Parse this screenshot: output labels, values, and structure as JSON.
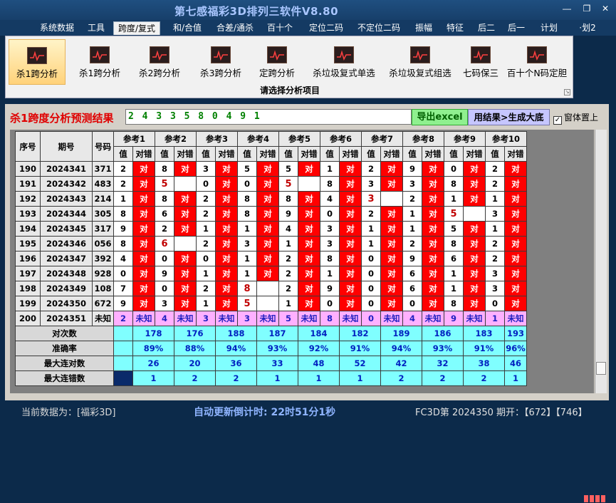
{
  "app": {
    "title": "第七感福彩3D排列三软件V8.80"
  },
  "menu": [
    {
      "label": "系统数据",
      "active": false
    },
    {
      "label": "工具",
      "active": false
    },
    {
      "label": "跨度/复式",
      "active": true
    },
    {
      "label": "和/合值",
      "active": false
    },
    {
      "label": "合差/通杀",
      "active": false
    },
    {
      "label": "百十个",
      "active": false
    },
    {
      "label": "定位二码",
      "active": false
    },
    {
      "label": "不定位二码",
      "active": false
    },
    {
      "label": "振幅",
      "active": false
    },
    {
      "label": "特征",
      "active": false
    },
    {
      "label": "后二",
      "active": false
    },
    {
      "label": "后一",
      "active": false
    },
    {
      "label": "计划",
      "active": false
    },
    {
      "label": "·划2",
      "active": false
    }
  ],
  "ribbon": {
    "caption": "请选择分析项目",
    "buttons": [
      {
        "label": "杀1跨分析",
        "selected": true
      },
      {
        "label": "杀1跨分析",
        "selected": false
      },
      {
        "label": "杀2跨分析",
        "selected": false
      },
      {
        "label": "杀3跨分析",
        "selected": false
      },
      {
        "label": "定跨分析",
        "selected": false
      },
      {
        "label": "杀垃圾复式单选",
        "selected": false
      },
      {
        "label": "杀垃圾复式组选",
        "selected": false
      },
      {
        "label": "七码保三",
        "selected": false
      },
      {
        "label": "百十个N码定胆",
        "selected": false
      }
    ]
  },
  "result": {
    "label": "杀1跨度分析预测结果",
    "value": "2 4 3 3 5 8 0 4 9 1",
    "export_button": "导出excel",
    "generate_button": "用结果>生成大底",
    "pin_label": "窗体置上",
    "pin_checked": true
  },
  "table": {
    "col_seq": "序号",
    "col_period": "期号",
    "col_number": "号码",
    "groups": [
      "参考1",
      "参考2",
      "参考3",
      "参考4",
      "参考5",
      "参考6",
      "参考7",
      "参考8",
      "参考9",
      "参考10"
    ],
    "sub_value": "值",
    "sub_check": "对错",
    "hit_text": "对",
    "rows": [
      {
        "seq": "190",
        "period": "2024341",
        "number": "371",
        "cells": [
          [
            "2",
            1
          ],
          [
            "8",
            1
          ],
          [
            "3",
            1
          ],
          [
            "5",
            1
          ],
          [
            "5",
            1
          ],
          [
            "1",
            1
          ],
          [
            "2",
            1
          ],
          [
            "9",
            1
          ],
          [
            "0",
            1
          ],
          [
            "2",
            1
          ]
        ]
      },
      {
        "seq": "191",
        "period": "2024342",
        "number": "483",
        "cells": [
          [
            "2",
            1
          ],
          [
            "5",
            0
          ],
          [
            "0",
            1
          ],
          [
            "0",
            1
          ],
          [
            "5",
            0
          ],
          [
            "8",
            1
          ],
          [
            "3",
            1
          ],
          [
            "3",
            1
          ],
          [
            "8",
            1
          ],
          [
            "2",
            1
          ]
        ]
      },
      {
        "seq": "192",
        "period": "2024343",
        "number": "214",
        "cells": [
          [
            "1",
            1
          ],
          [
            "8",
            1
          ],
          [
            "2",
            1
          ],
          [
            "8",
            1
          ],
          [
            "8",
            1
          ],
          [
            "4",
            1
          ],
          [
            "3",
            0
          ],
          [
            "2",
            1
          ],
          [
            "1",
            1
          ],
          [
            "1",
            1
          ]
        ]
      },
      {
        "seq": "193",
        "period": "2024344",
        "number": "305",
        "cells": [
          [
            "8",
            1
          ],
          [
            "6",
            1
          ],
          [
            "2",
            1
          ],
          [
            "8",
            1
          ],
          [
            "9",
            1
          ],
          [
            "0",
            1
          ],
          [
            "2",
            1
          ],
          [
            "1",
            1
          ],
          [
            "5",
            0
          ],
          [
            "3",
            1
          ]
        ]
      },
      {
        "seq": "194",
        "period": "2024345",
        "number": "317",
        "cells": [
          [
            "9",
            1
          ],
          [
            "2",
            1
          ],
          [
            "1",
            1
          ],
          [
            "1",
            1
          ],
          [
            "4",
            1
          ],
          [
            "3",
            1
          ],
          [
            "1",
            1
          ],
          [
            "1",
            1
          ],
          [
            "5",
            1
          ],
          [
            "1",
            1
          ]
        ]
      },
      {
        "seq": "195",
        "period": "2024346",
        "number": "056",
        "cells": [
          [
            "8",
            1
          ],
          [
            "6",
            0
          ],
          [
            "2",
            1
          ],
          [
            "3",
            1
          ],
          [
            "1",
            1
          ],
          [
            "3",
            1
          ],
          [
            "1",
            1
          ],
          [
            "2",
            1
          ],
          [
            "8",
            1
          ],
          [
            "2",
            1
          ]
        ]
      },
      {
        "seq": "196",
        "period": "2024347",
        "number": "392",
        "cells": [
          [
            "4",
            1
          ],
          [
            "0",
            1
          ],
          [
            "0",
            1
          ],
          [
            "1",
            1
          ],
          [
            "2",
            1
          ],
          [
            "8",
            1
          ],
          [
            "0",
            1
          ],
          [
            "9",
            1
          ],
          [
            "6",
            1
          ],
          [
            "2",
            1
          ]
        ]
      },
      {
        "seq": "197",
        "period": "2024348",
        "number": "928",
        "cells": [
          [
            "0",
            1
          ],
          [
            "9",
            1
          ],
          [
            "1",
            1
          ],
          [
            "1",
            1
          ],
          [
            "2",
            1
          ],
          [
            "1",
            1
          ],
          [
            "0",
            1
          ],
          [
            "6",
            1
          ],
          [
            "1",
            1
          ],
          [
            "3",
            1
          ]
        ]
      },
      {
        "seq": "198",
        "period": "2024349",
        "number": "108",
        "cells": [
          [
            "7",
            1
          ],
          [
            "0",
            1
          ],
          [
            "2",
            1
          ],
          [
            "8",
            0
          ],
          [
            "2",
            1
          ],
          [
            "9",
            1
          ],
          [
            "0",
            1
          ],
          [
            "6",
            1
          ],
          [
            "1",
            1
          ],
          [
            "3",
            1
          ]
        ]
      },
      {
        "seq": "199",
        "period": "2024350",
        "number": "672",
        "cells": [
          [
            "9",
            1
          ],
          [
            "3",
            1
          ],
          [
            "1",
            1
          ],
          [
            "5",
            0
          ],
          [
            "1",
            1
          ],
          [
            "0",
            1
          ],
          [
            "0",
            1
          ],
          [
            "0",
            1
          ],
          [
            "8",
            1
          ],
          [
            "0",
            1
          ]
        ]
      }
    ],
    "next_row": {
      "seq": "200",
      "period": "2024351",
      "number": "未知",
      "unknown": "未知",
      "values": [
        "2",
        "4",
        "3",
        "3",
        "5",
        "8",
        "0",
        "4",
        "9",
        "1"
      ]
    },
    "stats": [
      {
        "label": "对次数",
        "values": [
          "178",
          "176",
          "188",
          "187",
          "184",
          "182",
          "189",
          "186",
          "183",
          "193"
        ]
      },
      {
        "label": "准确率",
        "values": [
          "89%",
          "88%",
          "94%",
          "93%",
          "92%",
          "91%",
          "94%",
          "93%",
          "91%",
          "96%"
        ]
      },
      {
        "label": "最大连对数",
        "values": [
          "26",
          "20",
          "36",
          "33",
          "48",
          "52",
          "42",
          "32",
          "38",
          "46"
        ]
      },
      {
        "label": "最大连错数",
        "values": [
          "1",
          "2",
          "2",
          "1",
          "1",
          "1",
          "2",
          "2",
          "2",
          "1"
        ]
      }
    ]
  },
  "status": {
    "current_data": "当前数据为：[福彩3D]",
    "countdown": "自动更新倒计时:  22时51分1秒",
    "draw_info": "FC3D第 2024350 期开：【672】【746】"
  },
  "colors": {
    "hit": "#ff0000",
    "unknown": "#ffb0ff",
    "stats": "#80ffff"
  }
}
